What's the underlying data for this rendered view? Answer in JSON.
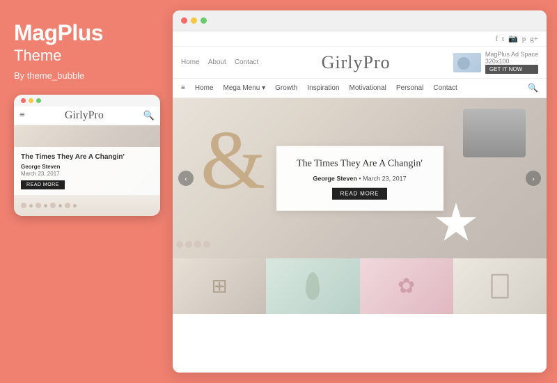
{
  "left": {
    "title": "MagPlus",
    "subtitle": "Theme",
    "author": "By theme_bubble"
  },
  "mobile": {
    "logo": "GirlyPro",
    "article_title": "The Times They Are A Changin'",
    "article_author": "George Steven",
    "article_date": "March 23, 2017",
    "read_more": "READ MORE"
  },
  "browser": {
    "top_nav": {
      "home": "Home",
      "about": "About",
      "contact": "Contact"
    },
    "social_icons": [
      "f",
      "t",
      "in",
      "p",
      "g+"
    ],
    "logo": "GirlyPro",
    "ad": {
      "title": "MagPlus Ad Space",
      "size": "320x100",
      "button": "GET IT NOW"
    },
    "main_nav": {
      "hamburger": "≡",
      "items": [
        "Home",
        "Mega Menu ▾",
        "Growth",
        "Inspiration",
        "Motivational",
        "Personal",
        "Contact"
      ],
      "search": "🔍"
    },
    "hero": {
      "article_title": "The Times They Are A Changin'",
      "article_author": "George Steven",
      "article_date": "March 23, 2017",
      "read_more": "READ MORE",
      "arrow_left": "‹",
      "arrow_right": "›"
    }
  }
}
